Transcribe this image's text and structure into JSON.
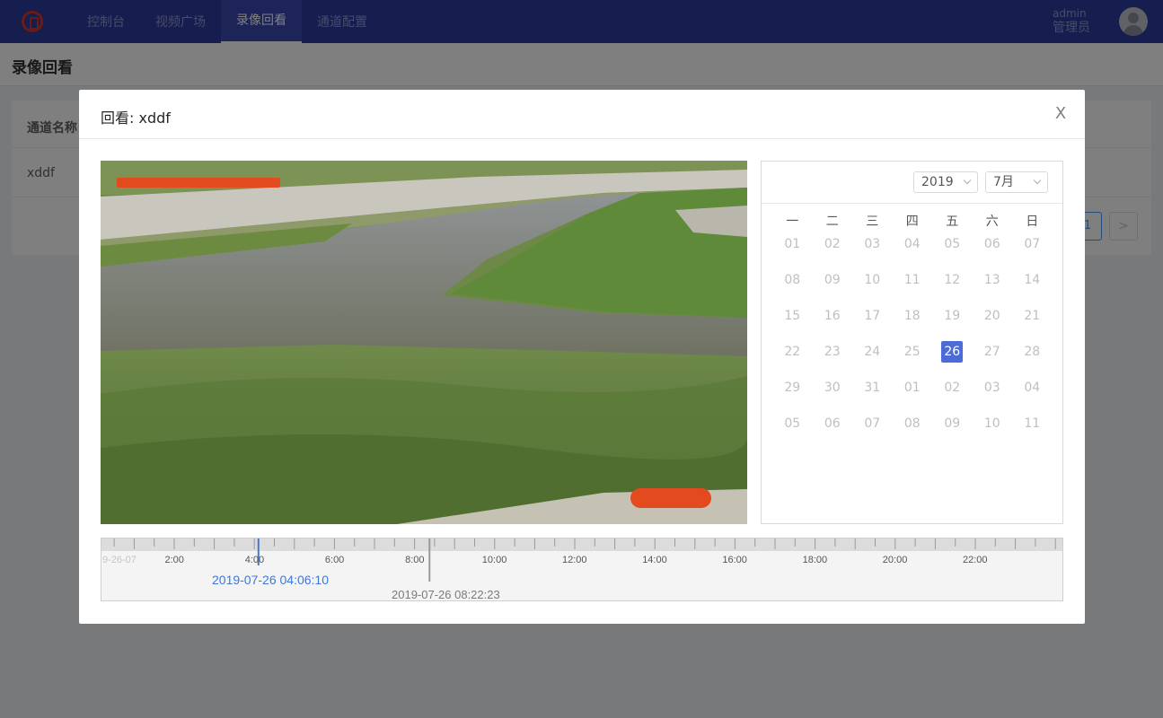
{
  "nav": {
    "items": [
      {
        "label": "控制台"
      },
      {
        "label": "视频广场"
      },
      {
        "label": "录像回看",
        "active": true
      },
      {
        "label": "通道配置"
      }
    ],
    "user_name": "admin",
    "user_role": "管理员",
    "icons": {
      "logo": "logo-icon",
      "avatar": "avatar-icon"
    }
  },
  "page": {
    "title": "录像回看",
    "table_header": "通道名称",
    "table_row": "xddf",
    "pager_current": "1",
    "pager_next": ">"
  },
  "dialog": {
    "title": "回看: xddf",
    "close_label": "X",
    "calendar": {
      "year": "2019",
      "month": "7月",
      "weekdays": [
        "一",
        "二",
        "三",
        "四",
        "五",
        "六",
        "日"
      ],
      "weeks": [
        [
          "01",
          "02",
          "03",
          "04",
          "05",
          "06",
          "07"
        ],
        [
          "08",
          "09",
          "10",
          "11",
          "12",
          "13",
          "14"
        ],
        [
          "15",
          "16",
          "17",
          "18",
          "19",
          "20",
          "21"
        ],
        [
          "22",
          "23",
          "24",
          "25",
          "26",
          "27",
          "28"
        ],
        [
          "29",
          "30",
          "31",
          "01",
          "02",
          "03",
          "04"
        ],
        [
          "05",
          "06",
          "07",
          "08",
          "09",
          "10",
          "11"
        ]
      ],
      "selected": "26"
    },
    "timeline": {
      "start_label": "9-26-07",
      "hour_labels": [
        "2:00",
        "4:00",
        "6:00",
        "8:00",
        "10:00",
        "12:00",
        "14:00",
        "16:00",
        "18:00",
        "20:00",
        "22:00"
      ],
      "cursor_time": "2019-07-26 04:06:10",
      "end_time": "2019-07-26 08:22:23",
      "accent_color": "#3f78d8"
    }
  }
}
